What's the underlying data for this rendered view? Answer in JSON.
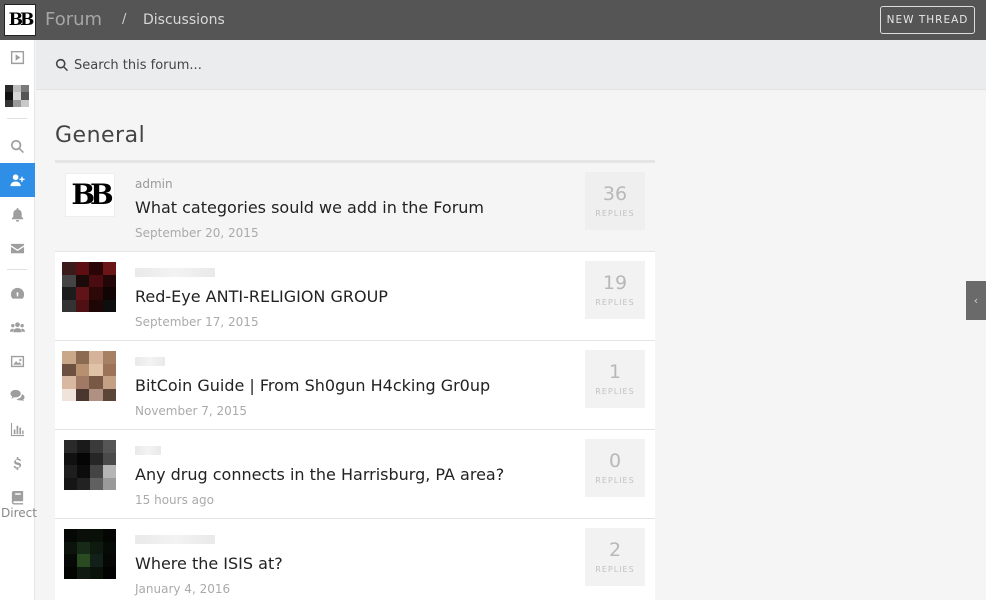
{
  "header": {
    "brand": "Forum",
    "separator": "/",
    "breadcrumb": "Discussions",
    "new_thread_label": "NEW THREAD",
    "logo_icon": "bb-logo-icon"
  },
  "sidebar": {
    "items": [
      {
        "name": "video-icon",
        "active": false
      },
      {
        "name": "search-icon",
        "active": false
      },
      {
        "name": "add-user-icon",
        "active": true
      },
      {
        "name": "bell-icon",
        "active": false
      },
      {
        "name": "envelope-icon",
        "active": false
      },
      {
        "name": "dashboard-icon",
        "active": false
      },
      {
        "name": "users-icon",
        "active": false
      },
      {
        "name": "image-icon",
        "active": false
      },
      {
        "name": "comments-icon",
        "active": false
      },
      {
        "name": "bar-chart-icon",
        "active": false
      },
      {
        "name": "dollar-icon",
        "active": false
      },
      {
        "name": "book-icon",
        "active": false
      }
    ],
    "bottom_label": "Direct"
  },
  "search": {
    "placeholder": "Search this forum..."
  },
  "section": {
    "title": "General"
  },
  "threads": [
    {
      "author": "admin",
      "title": "What categories sould we add in the Forum",
      "date": "September 20, 2015",
      "replies": "36",
      "replies_label": "REPLIES"
    },
    {
      "author": "",
      "title": "Red-Eye ANTI-RELIGION GROUP",
      "date": "September 17, 2015",
      "replies": "19",
      "replies_label": "REPLIES"
    },
    {
      "author": "",
      "title": "BitCoin Guide | From Sh0gun H4cking Gr0up",
      "date": "November 7, 2015",
      "replies": "1",
      "replies_label": "REPLIES"
    },
    {
      "author": "",
      "title": "Any drug connects in the Harrisburg, PA area?",
      "date": "15 hours ago",
      "replies": "0",
      "replies_label": "REPLIES"
    },
    {
      "author": "",
      "title": "Where the ISIS at?",
      "date": "January 4, 2016",
      "replies": "2",
      "replies_label": "REPLIES"
    }
  ],
  "colors": {
    "topbar": "#555555",
    "accent": "#2f8ee5"
  }
}
